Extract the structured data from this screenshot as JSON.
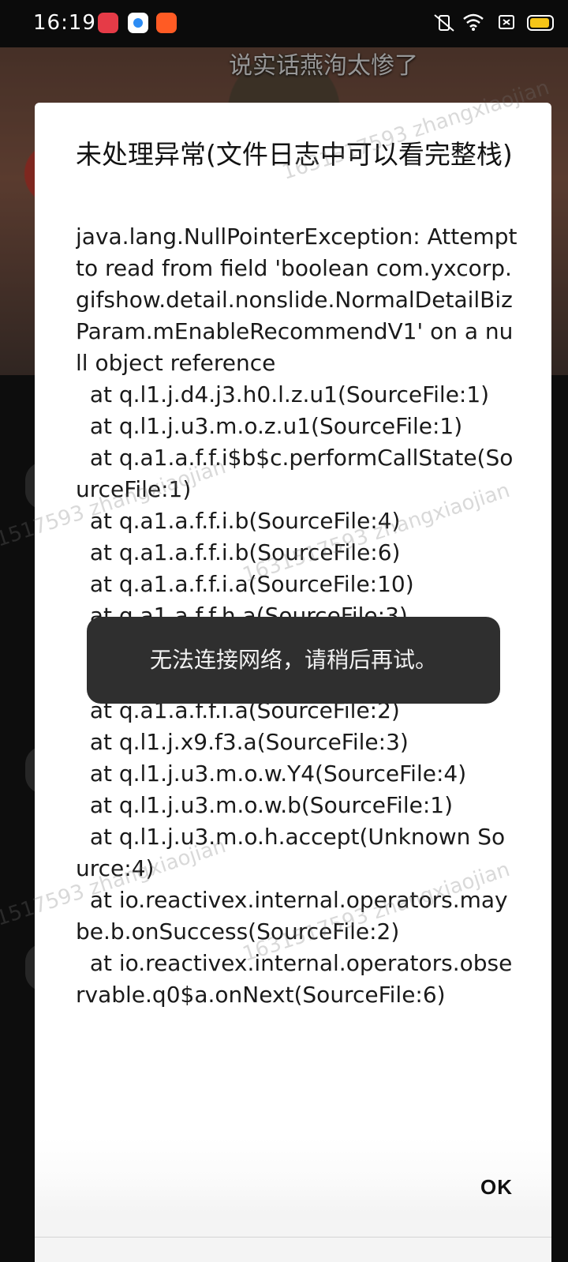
{
  "status_bar": {
    "time": "16:19",
    "app_icons": [
      "screen-recorder-icon",
      "browser-icon",
      "app-store-icon"
    ],
    "right_icons": [
      "mute-vibrate-icon",
      "wifi-icon",
      "sim-icon",
      "battery-icon"
    ],
    "battery_color": "#f5c518"
  },
  "background": {
    "video_banner": "说实话燕洵太惨了",
    "watermark": "1631517593 zhangxiaojian"
  },
  "dialog": {
    "title": "未处理异常(文件日志中可以看完整栈)",
    "body": "java.lang.NullPointerException: Attempt to read from field 'boolean com.yxcorp.gifshow.detail.nonslide.NormalDetailBizParam.mEnableRecommendV1' on a null object reference\n  at q.l1.j.d4.j3.h0.l.z.u1(SourceFile:1)\n  at q.l1.j.u3.m.o.z.u1(SourceFile:1)\n  at q.a1.a.f.f.i$b$c.performCallState(SourceFile:1)\n  at q.a1.a.f.f.i.b(SourceFile:4)\n  at q.a1.a.f.f.i.b(SourceFile:6)\n  at q.a1.a.f.f.i.a(SourceFile:10)\n  at q.a1.a.f.f.h.a(SourceFile:3)\n  at q.a1.a.f.f.i.a(SourceFile:3)\n  at q.a1.a.f.f.i.a(SourceFile:13)\n  at q.a1.a.f.f.i.a(SourceFile:2)\n  at q.l1.j.x9.f3.a(SourceFile:3)\n  at q.l1.j.u3.m.o.w.Y4(SourceFile:4)\n  at q.l1.j.u3.m.o.w.b(SourceFile:1)\n  at q.l1.j.u3.m.o.h.accept(Unknown Source:4)\n  at io.reactivex.internal.operators.maybe.b.onSuccess(SourceFile:2)\n  at io.reactivex.internal.operators.observable.q0$a.onNext(SourceFile:6)",
    "ok_label": "OK"
  },
  "toast": {
    "message": "无法连接网络，请稍后再试。"
  }
}
